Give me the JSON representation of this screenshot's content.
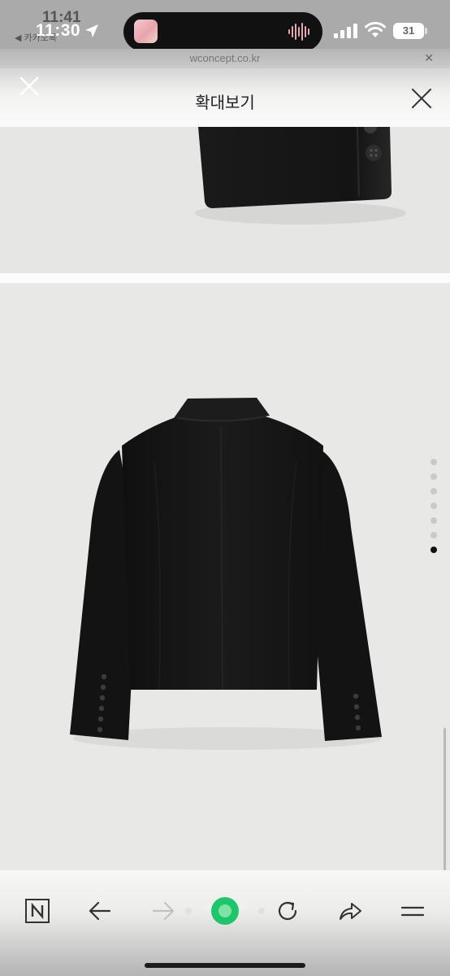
{
  "status_bar": {
    "ghost_time": "11:41",
    "ghost_back": "◀ 카카오톡",
    "time": "11:30",
    "battery": "31"
  },
  "browser": {
    "url": "wconcept.co.kr"
  },
  "viewer": {
    "title": "확대보기",
    "page_dots": 7,
    "active_dot": 7
  },
  "icons": {
    "location": "location-arrow-icon",
    "signal": "cell-signal-icon",
    "wifi": "wifi-icon",
    "battery": "battery-icon",
    "close": "close-icon",
    "naver": "naver-n-icon",
    "back": "arrow-left-icon",
    "forward": "arrow-right-icon",
    "reload": "reload-icon",
    "share": "share-icon",
    "menu": "menu-icon"
  },
  "colors": {
    "jacket": "#151515",
    "background": "#e8e8e6",
    "accent_green": "#1fc56a"
  }
}
